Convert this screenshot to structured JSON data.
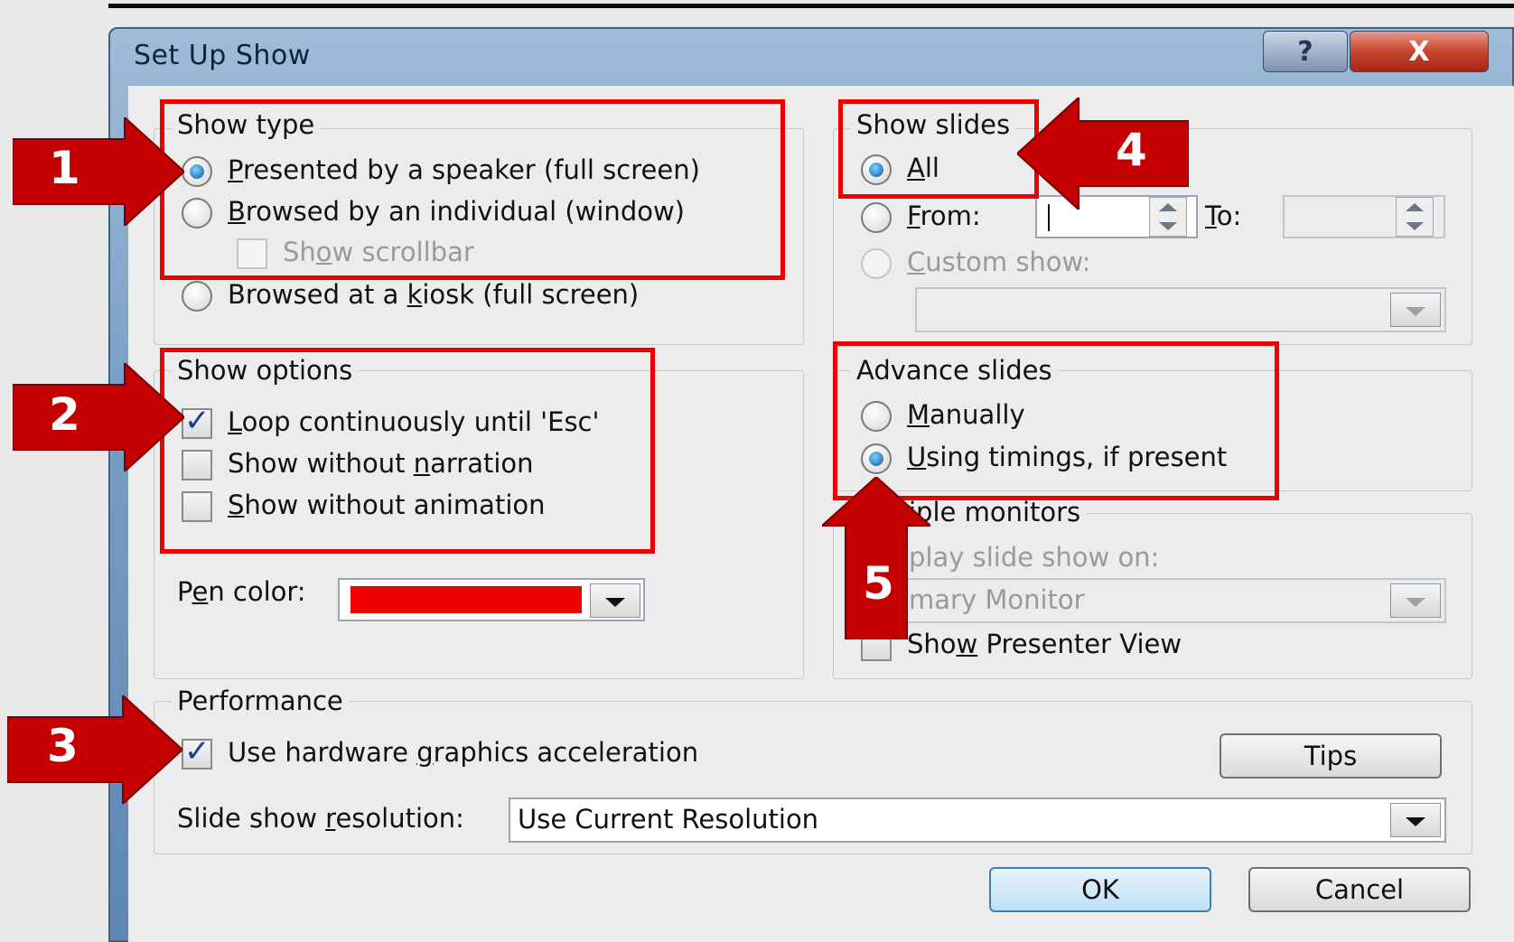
{
  "dialog": {
    "title": "Set Up Show",
    "help_button": "?",
    "close_button": "X"
  },
  "show_type": {
    "label": "Show type",
    "options": [
      {
        "pre": "",
        "ul": "P",
        "post": "resented by a speaker (full screen)",
        "selected": true
      },
      {
        "pre": "",
        "ul": "B",
        "post": "rowsed by an individual (window)",
        "selected": false
      },
      {
        "pre": "Browsed at a ",
        "ul": "k",
        "post": "iosk (full screen)",
        "selected": false
      }
    ],
    "scrollbar": {
      "pre": "Sh",
      "ul": "o",
      "post": "w scrollbar",
      "checked": false,
      "disabled": true
    }
  },
  "show_options": {
    "label": "Show options",
    "items": [
      {
        "pre": "",
        "ul": "L",
        "post": "oop continuously until 'Esc'",
        "checked": true
      },
      {
        "pre": "Show without ",
        "ul": "n",
        "post": "arration",
        "checked": false
      },
      {
        "pre": "",
        "ul": "S",
        "post": "how without animation",
        "checked": false
      }
    ],
    "pen_color": {
      "pre": "P",
      "ul": "e",
      "post": "n color:",
      "value": "#ee0000"
    }
  },
  "show_slides": {
    "label": "Show slides",
    "all": {
      "ul": "A",
      "post": "ll",
      "selected": true
    },
    "from": {
      "ul": "F",
      "post": "rom:",
      "selected": false,
      "value": ""
    },
    "to": {
      "ul": "T",
      "post": "o:",
      "value": ""
    },
    "custom": {
      "ul": "C",
      "post": "ustom show:",
      "selected": false,
      "disabled": true,
      "value": ""
    }
  },
  "advance_slides": {
    "label": "Advance slides",
    "options": [
      {
        "ul": "M",
        "post": "anually",
        "selected": false
      },
      {
        "ul": "U",
        "post": "sing timings, if present",
        "selected": true
      }
    ]
  },
  "multiple_monitors": {
    "label": "iple monitors",
    "display_on_label": "play slide show on:",
    "monitor_value": "mary Monitor",
    "presenter_view": {
      "pre": "Sho",
      "ul": "w",
      "post": " Presenter View",
      "checked": false
    }
  },
  "performance": {
    "label": "Performance",
    "hw_accel": {
      "pre": "Use hardware ",
      "ul": "g",
      "post": "raphics acceleration",
      "checked": true
    },
    "tips_button": "Tips",
    "resolution_label": {
      "pre": "Slide show ",
      "ul": "r",
      "post": "esolution:"
    },
    "resolution_value": "Use Current Resolution"
  },
  "buttons": {
    "ok": "OK",
    "cancel": "Cancel"
  },
  "annotations": {
    "n1": "1",
    "n2": "2",
    "n3": "3",
    "n4": "4",
    "n5": "5",
    "color": "#c40000"
  }
}
